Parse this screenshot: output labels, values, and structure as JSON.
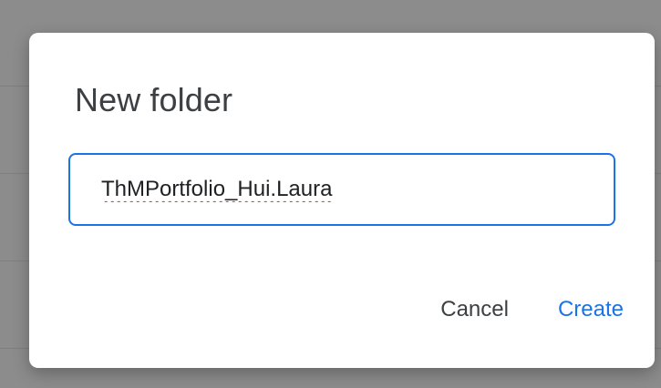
{
  "dialog": {
    "title": "New folder",
    "input": {
      "value": "ThMPortfolio_Hui.Laura",
      "spellcheck_flag": true
    },
    "cancel_label": "Cancel",
    "create_label": "Create"
  },
  "colors": {
    "accent": "#1a73e8",
    "title_text": "#3c4043",
    "backdrop": "#8c8c8c",
    "spellcheck_underline": "#d93025"
  }
}
